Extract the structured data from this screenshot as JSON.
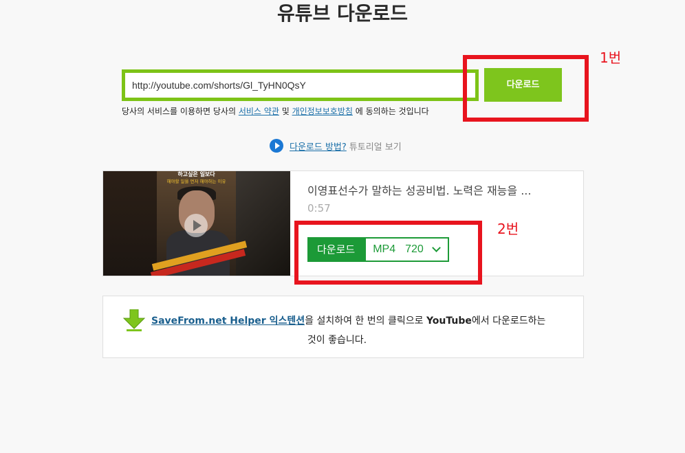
{
  "header": {
    "title": "유튜브 다운로드"
  },
  "search": {
    "url_value": "http://youtube.com/shorts/Gl_TyHN0QsY",
    "download_label": "다운로드"
  },
  "terms": {
    "prefix": "당사의 서비스를 이용하면 당사의",
    "link_terms": "서비스 약관",
    "and": "및",
    "link_privacy": "개인정보보호방침",
    "suffix": "에 동의하는 것입니다"
  },
  "howto": {
    "link": "다운로드 방법?",
    "sub": "튜토리얼 보기"
  },
  "result": {
    "thumbnail_caption_1": "하고싶은 일보다",
    "thumbnail_caption_2": "해야할 일을 먼저 해야하는 이유",
    "title": "이영표선수가 말하는 성공비법. 노력은 재능을 ...",
    "duration": "0:57",
    "download_label": "다운로드",
    "format": "MP4",
    "quality": "720"
  },
  "helper": {
    "link": "SaveFrom.net Helper 익스텐션",
    "text_1": "을 설치하여 한 번의 클릭으로",
    "brand": "YouTube",
    "text_2": "에서 다운로드하는",
    "text_3": "것이 좋습니다."
  },
  "annotations": {
    "label_1": "1번",
    "label_2": "2번",
    "color": "#e8141e"
  },
  "colors": {
    "input_border": "#7dc317",
    "primary_button": "#7ec51d",
    "download_green": "#1c9a37",
    "link": "#1a6fa8"
  }
}
